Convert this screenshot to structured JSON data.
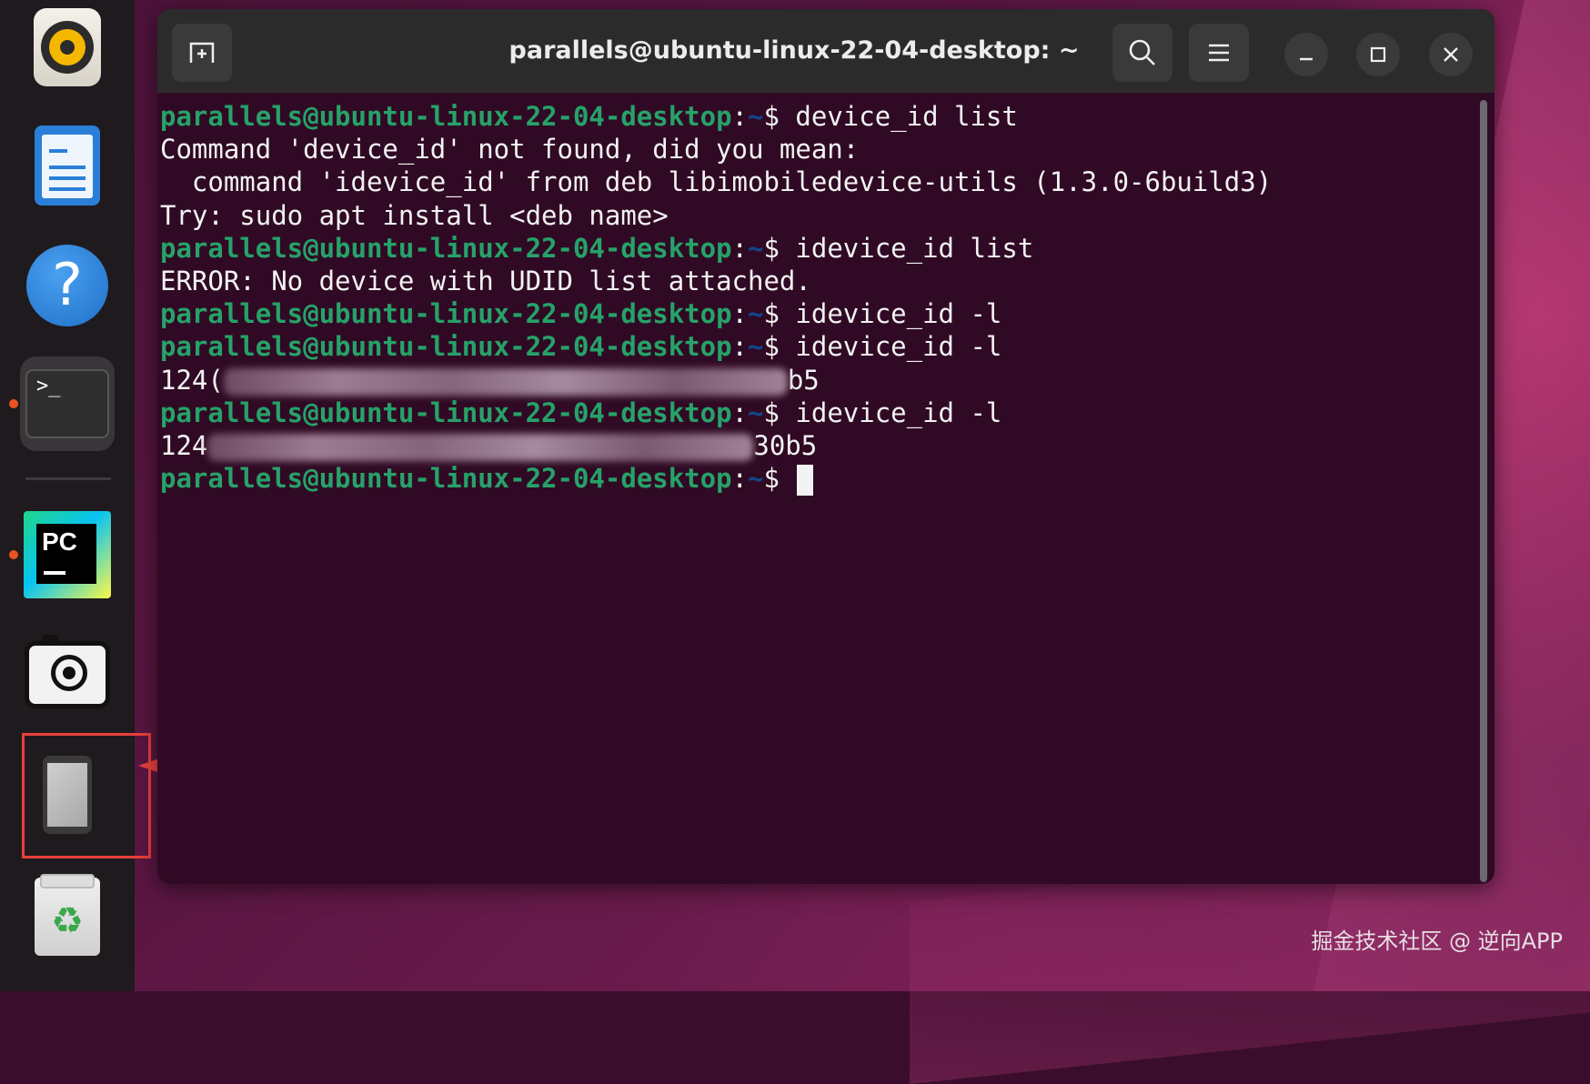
{
  "window": {
    "title": "parallels@ubuntu-linux-22-04-desktop: ~"
  },
  "terminal": {
    "prompt_user": "parallels@ubuntu-linux-22-04-desktop",
    "prompt_sep": ":",
    "prompt_path": "~",
    "prompt_symbol": "$ ",
    "lines": [
      {
        "type": "prompt",
        "cmd": "device_id list"
      },
      {
        "type": "out",
        "text": "Command 'device_id' not found, did you mean:"
      },
      {
        "type": "out",
        "text": "  command 'idevice_id' from deb libimobiledevice-utils (1.3.0-6build3)"
      },
      {
        "type": "out",
        "text": "Try: sudo apt install <deb name>"
      },
      {
        "type": "prompt",
        "cmd": "idevice_id list"
      },
      {
        "type": "out",
        "text": "ERROR: No device with UDID list attached."
      },
      {
        "type": "prompt",
        "cmd": "idevice_id -l"
      },
      {
        "type": "prompt",
        "cmd": "idevice_id -l"
      },
      {
        "type": "udid",
        "prefix": "124(",
        "suffix": "b5"
      },
      {
        "type": "prompt",
        "cmd": "idevice_id -l"
      },
      {
        "type": "udid",
        "prefix": "124",
        "suffix": "30b5"
      },
      {
        "type": "prompt_cursor",
        "cmd": ""
      }
    ]
  },
  "dock": {
    "items": [
      {
        "name": "rhythmbox",
        "icon": "music-disc-icon"
      },
      {
        "name": "writer",
        "icon": "document-icon"
      },
      {
        "name": "help",
        "icon": "help-icon",
        "glyph": "?"
      },
      {
        "name": "terminal",
        "icon": "terminal-icon",
        "glyph": ">_"
      },
      {
        "name": "pycharm",
        "icon": "pycharm-icon",
        "glyph": "PC"
      },
      {
        "name": "camera",
        "icon": "camera-icon"
      },
      {
        "name": "device",
        "icon": "phone-device-icon"
      },
      {
        "name": "trash",
        "icon": "recycle-icon",
        "glyph": "♻"
      }
    ]
  },
  "watermark": "掘金技术社区 @ 逆向APP",
  "colors": {
    "terminal_bg": "#300a24",
    "prompt_user": "#26a269",
    "prompt_path": "#12488b",
    "highlight": "#e8403c"
  }
}
